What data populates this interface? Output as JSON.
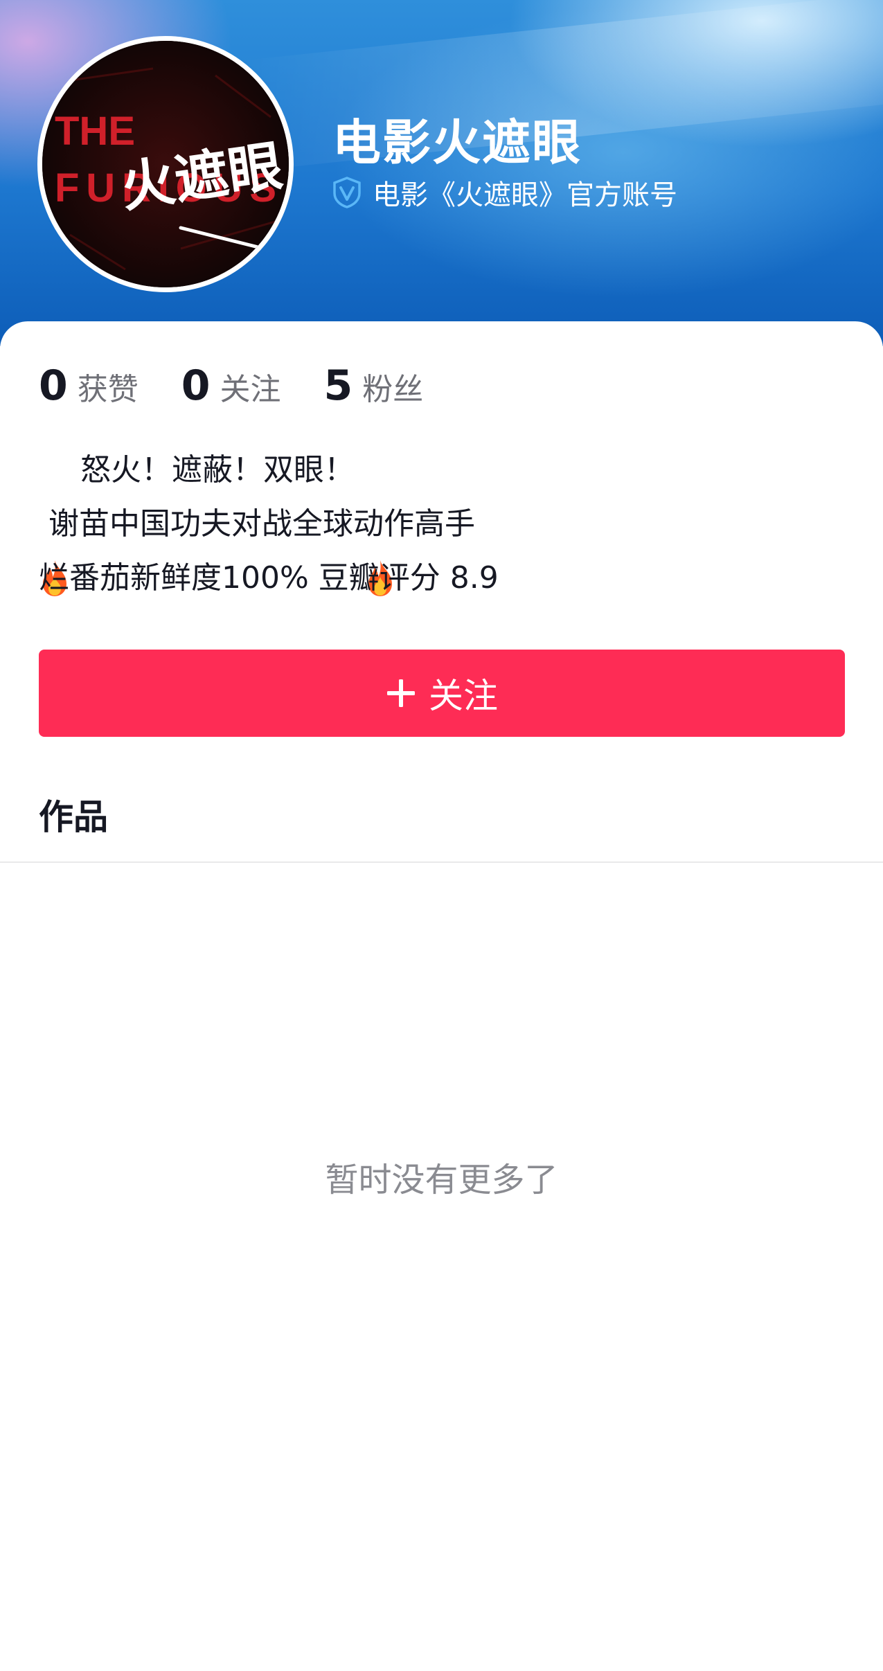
{
  "colors": {
    "accent": "#fe2c55",
    "verify_badge": "#5ab7f7",
    "banner_blue": "#1d77cf",
    "text_primary": "#161823",
    "text_secondary": "#6f7077",
    "fire": "#ff5a1f"
  },
  "avatar": {
    "icon": "movie-poster-avatar",
    "text_en_line1": "THE",
    "text_en_line2": "FURIOUS",
    "text_cn": "火遮眼"
  },
  "profile": {
    "name": "电影火遮眼",
    "verify_icon": "verified-badge-icon",
    "verified_text": "电影《火遮眼》官方账号"
  },
  "stats": [
    {
      "value": "0",
      "label": "获赞"
    },
    {
      "value": "0",
      "label": "关注"
    },
    {
      "value": "5",
      "label": "粉丝"
    }
  ],
  "bio": {
    "fire_icon": "fire-icon",
    "line1": " 怒火！遮蔽！双眼！ ",
    "line2": " 谢苗中国功夫对战全球动作高手",
    "line3": "烂番茄新鲜度100% 豆瓣评分 8.9"
  },
  "follow_button": {
    "icon": "plus-icon",
    "label": "关注"
  },
  "tabs": {
    "works_label": "作品"
  },
  "empty_state": {
    "text": "暂时没有更多了"
  }
}
